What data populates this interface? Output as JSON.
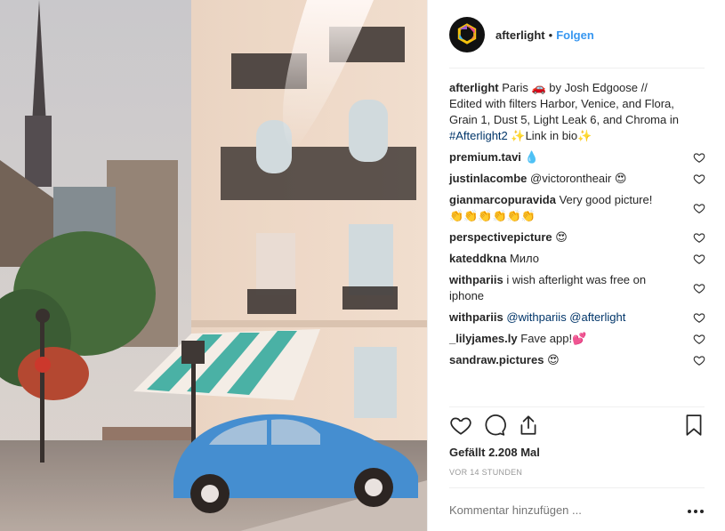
{
  "header": {
    "username": "afterlight",
    "separator": "•",
    "follow_label": "Folgen",
    "avatar_icon": "afterlight-logo-icon"
  },
  "caption": {
    "author": "afterlight",
    "text_part1": "Paris ",
    "car_emoji": "🚗",
    "text_part2": " by Josh Edgoose // Edited with filters Harbor, Venice, and Flora, Grain 1, Dust 5, Light Leak 6, and Chroma in ",
    "hashtag": "#Afterlight2",
    "text_part3": " ✨Link in bio✨"
  },
  "comments": [
    {
      "user": "premium.tavi",
      "text": "💧"
    },
    {
      "user": "justinlacombe",
      "text": "@victorontheair 😍"
    },
    {
      "user": "gianmarcopuravida",
      "text": "Very good picture! 👏👏👏👏👏👏"
    },
    {
      "user": "perspectivepicture",
      "text": "😍"
    },
    {
      "user": "kateddkna",
      "text": "Мило"
    },
    {
      "user": "withpariis",
      "text": "i wish afterlight was free on iphone"
    },
    {
      "user": "withpariis",
      "text": "@withpariis @afterlight"
    },
    {
      "user": "_lilyjames.ly",
      "text": "Fave app!💕"
    },
    {
      "user": "sandraw.pictures",
      "text": "😍"
    }
  ],
  "likes_text": "Gefällt 2.208 Mal",
  "time_text": "VOR 14 STUNDEN",
  "comment_placeholder": "Kommentar hinzufügen ...",
  "icons": {
    "like": "heart-outline-icon",
    "comment": "speech-bubble-icon",
    "share": "share-icon",
    "save": "bookmark-icon",
    "more": "more-dots-icon"
  },
  "colors": {
    "link": "#3897f0",
    "hashtag": "#003569",
    "text": "#262626",
    "muted": "#999999",
    "divider": "#efefef"
  }
}
